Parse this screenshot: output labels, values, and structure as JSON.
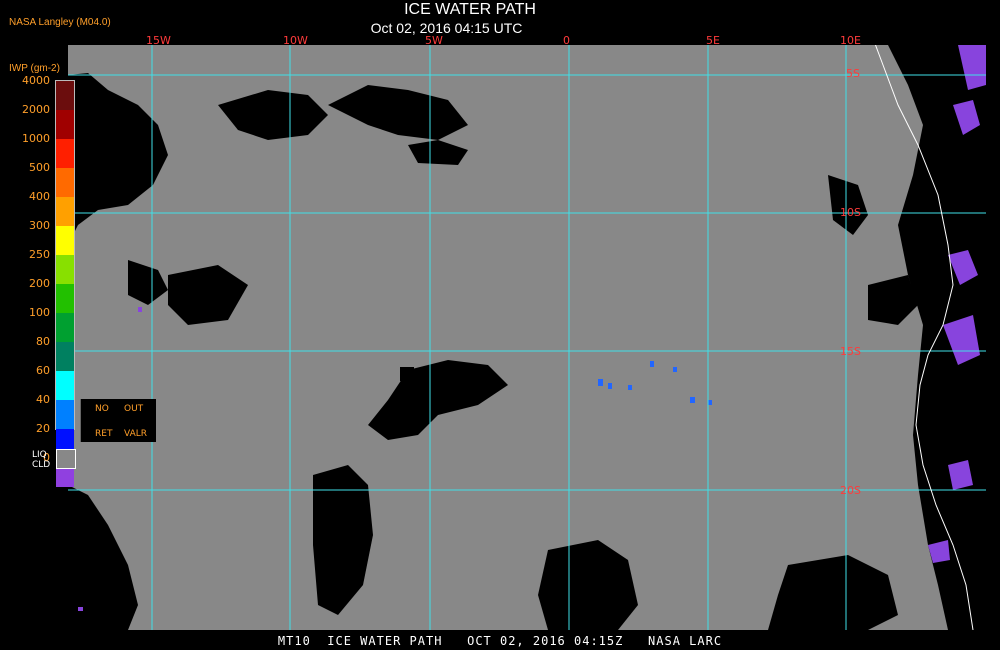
{
  "header": {
    "title": "ICE WATER PATH",
    "subtitle": "Oct 02, 2016 04:15 UTC",
    "credit": "NASA Langley (M04.0)"
  },
  "legend": {
    "unit_label": "IWP (gm-2)",
    "scale": [
      {
        "label": "4000",
        "color": "#6b0d0d"
      },
      {
        "label": "2000",
        "color": "#a00000"
      },
      {
        "label": "1000",
        "color": "#ff1f00"
      },
      {
        "label": "500",
        "color": "#ff6a00"
      },
      {
        "label": "400",
        "color": "#ffa000"
      },
      {
        "label": "300",
        "color": "#ffff00"
      },
      {
        "label": "250",
        "color": "#88e000"
      },
      {
        "label": "200",
        "color": "#22c000"
      },
      {
        "label": "100",
        "color": "#00a030"
      },
      {
        "label": "80",
        "color": "#008060"
      },
      {
        "label": "60",
        "color": "#00ffff"
      },
      {
        "label": "40",
        "color": "#0080ff"
      },
      {
        "label": "20",
        "color": "#0010ff"
      },
      {
        "label": "0",
        "color": "#9040e0"
      }
    ],
    "flags": {
      "no": "NO",
      "out": "OUT",
      "ret": "RET",
      "valr": "VALR"
    },
    "liq_line1": "LIQ",
    "liq_line2": "CLD",
    "liq_color": "#888888"
  },
  "map": {
    "ocean_color": "#888888",
    "clear_color": "#000000",
    "grid_color": "#40e0e8",
    "ice_color": "#8844dd",
    "longitude_labels": [
      "15W",
      "10W",
      "5W",
      "0",
      "5E",
      "10E"
    ],
    "latitude_labels": [
      "5S",
      "10S",
      "15S",
      "20S"
    ]
  },
  "footer": {
    "text": "MT10  ICE WATER PATH   OCT 02, 2016 04:15Z   NASA LARC"
  }
}
